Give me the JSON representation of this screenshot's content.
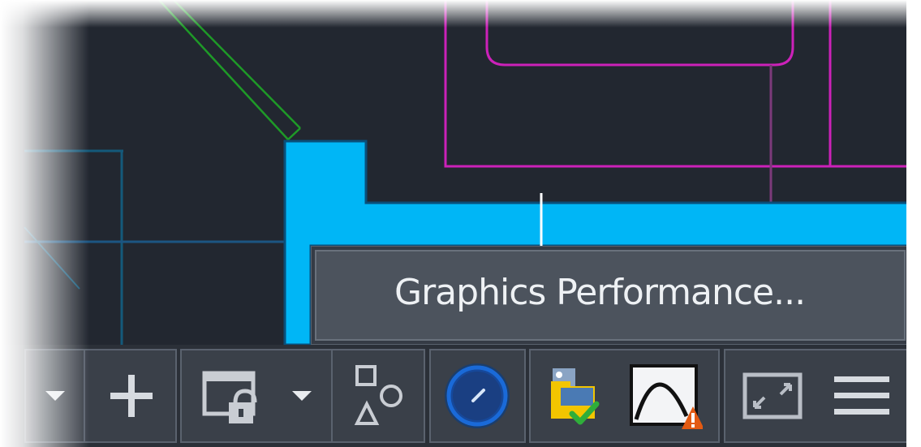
{
  "tooltip": {
    "label": "Graphics Performance..."
  },
  "statusbar": {
    "buttons": [
      {
        "id": "dropdown-1",
        "icon": "chevron-down-icon"
      },
      {
        "id": "snap",
        "icon": "plus-icon"
      },
      {
        "id": "viewport-lock",
        "icon": "viewport-lock-icon"
      },
      {
        "id": "dropdown-2",
        "icon": "chevron-down-icon"
      },
      {
        "id": "isolate",
        "icon": "isolate-objects-icon"
      },
      {
        "id": "hardware-acceleration",
        "icon": "gauge-icon"
      },
      {
        "id": "annotation-monitor",
        "icon": "folder-check-icon"
      },
      {
        "id": "graphics-performance",
        "icon": "curve-warning-icon"
      },
      {
        "id": "clean-screen",
        "icon": "fullscreen-icon"
      },
      {
        "id": "customization",
        "icon": "hamburger-menu-icon"
      }
    ]
  },
  "colors": {
    "canvas": "#222730",
    "accent_cyan": "#00b6f6",
    "magenta": "#cc21b9",
    "green": "#1e9a27",
    "statusbar": "#3a4049",
    "gauge_blue": "#1a6ad8"
  }
}
